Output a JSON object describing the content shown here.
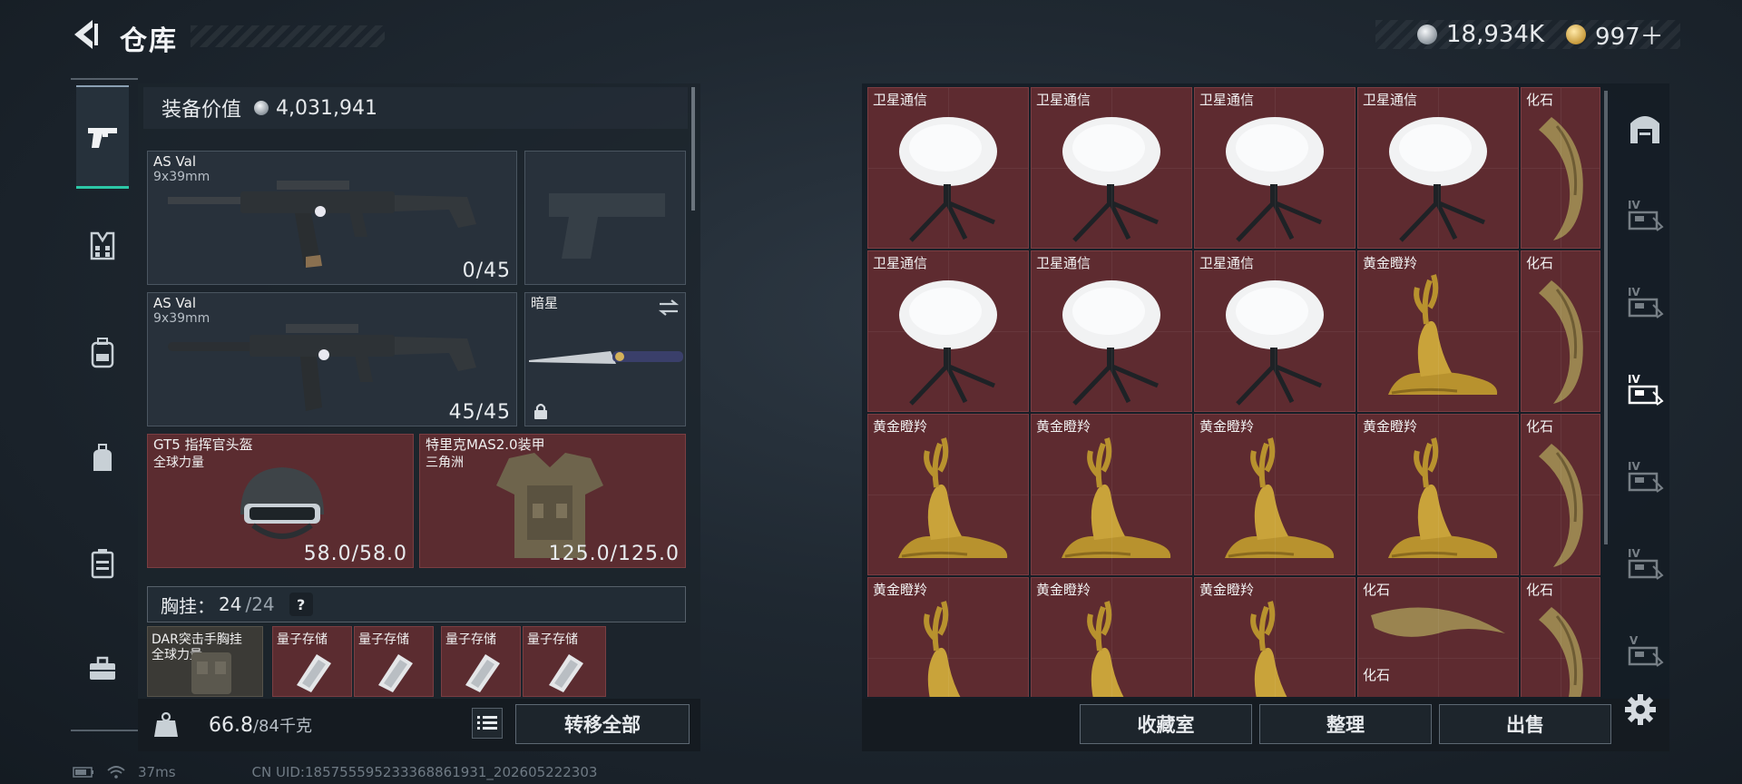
{
  "header": {
    "title": "仓库",
    "currency_silver": "18,934K",
    "currency_gold": "997＋"
  },
  "left_nav": {
    "items": [
      "gun-icon",
      "vest-icon",
      "backpack-icon",
      "bag-icon",
      "case-icon",
      "toolbox-icon"
    ],
    "active": "gun-icon"
  },
  "equipment": {
    "value_label": "装备价值",
    "value": "4,031,941",
    "primary_weapon": {
      "name": "AS Val",
      "caliber": "9x39mm",
      "ammo": "0/45"
    },
    "secondary_weapon": {
      "name": "AS Val",
      "caliber": "9x39mm",
      "ammo": "45/45"
    },
    "melee": {
      "name": "暗星"
    },
    "helmet": {
      "name": "GT5 指挥官头盔",
      "sub": "全球力量",
      "durability": "58.0/58.0"
    },
    "armor": {
      "name": "特里克MAS2.0装甲",
      "sub": "三角洲",
      "durability": "125.0/125.0"
    },
    "chest_rig": {
      "label": "胸挂：",
      "used": "24",
      "capacity": "/24",
      "help": "?"
    },
    "chest_rig_item": {
      "name": "DAR突击手胸挂",
      "sub": "全球力量"
    },
    "quantum_items": [
      "量子存储",
      "量子存储",
      "量子存储",
      "量子存储"
    ]
  },
  "footer_left": {
    "weight_current": "66.8",
    "weight_max": "/84千克",
    "transfer_all": "转移全部"
  },
  "status": {
    "ping": "37ms",
    "uid": "CN UID:18575559523336886193​1_202605222303"
  },
  "grid": {
    "rows": [
      [
        "卫星通信",
        "卫星通信",
        "卫星通信",
        "卫星通信",
        "化石"
      ],
      [
        "卫星通信",
        "卫星通信",
        "卫星通信",
        "黄金瞪羚",
        "化石"
      ],
      [
        "黄金瞪羚",
        "黄金瞪羚",
        "黄金瞪羚",
        "黄金瞪羚",
        "化石"
      ],
      [
        "黄金瞪羚",
        "黄金瞪羚",
        "黄金瞪羚",
        "化石",
        "化石"
      ]
    ],
    "extra_label": "化石"
  },
  "right_tabs": {
    "labels": [
      "",
      "IV",
      "IV",
      "IV",
      "IV",
      "IV",
      "V"
    ],
    "active_index": 3
  },
  "actions": {
    "collection": "收藏室",
    "organize": "整理",
    "sell": "出售"
  }
}
